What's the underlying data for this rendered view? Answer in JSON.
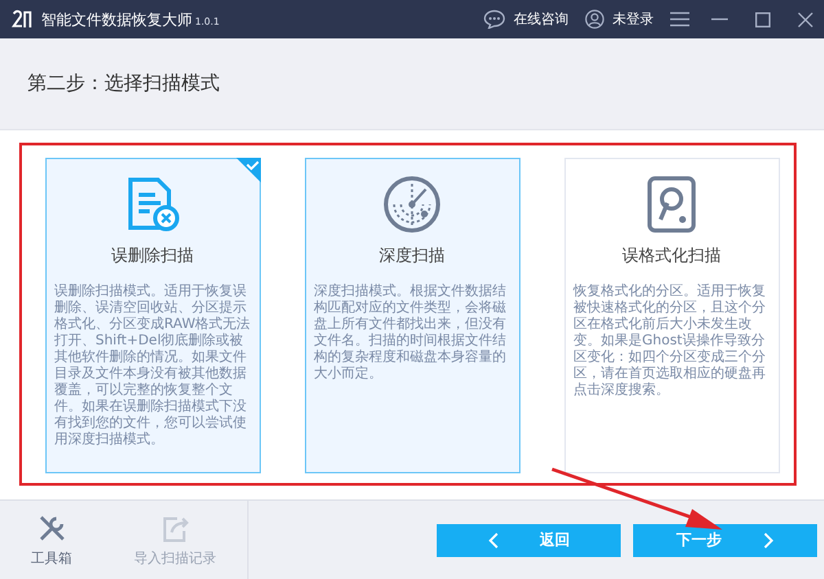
{
  "window": {
    "title": "智能文件数据恢复大师",
    "version": "1.0.1",
    "actions": [
      {
        "kind": "chat",
        "label": "在线咨询"
      },
      {
        "kind": "user",
        "label": "未登录"
      }
    ]
  },
  "step_title": "第二步：选择扫描模式",
  "modes": [
    {
      "kind": "deleted",
      "title": "误删除扫描",
      "selected": true,
      "highlighted": true,
      "description": "误删除扫描模式。适用于恢复误删除、误清空回收站、分区提示格式化、分区变成RAW格式无法打开、Shift+Del彻底删除或被其他软件删除的情况。如果文件目录及文件本身没有被其他数据覆盖，可以完整的恢复整个文件。如果在误删除扫描模式下没有找到您的文件，您可以尝试使用深度扫描模式。"
    },
    {
      "kind": "deep",
      "title": "深度扫描",
      "selected": false,
      "highlighted": true,
      "description": "深度扫描模式。根据文件数据结构匹配对应的文件类型，会将磁盘上所有文件都找出来，但没有文件名。扫描的时间根据文件结构的复杂程度和磁盘本身容量的大小而定。"
    },
    {
      "kind": "format",
      "title": "误格式化扫描",
      "selected": false,
      "highlighted": false,
      "description": "恢复格式化的分区。适用于恢复被快速格式化的分区，且这个分区在格式化前后大小未发生改变。如果是Ghost误操作导致分区变化：如四个分区变成三个分区，请在首页选取相应的硬盘再点击深度搜索。"
    }
  ],
  "tools": [
    {
      "kind": "toolbox",
      "label": "工具箱",
      "disabled": false
    },
    {
      "kind": "import",
      "label": "导入扫描记录",
      "disabled": true
    }
  ],
  "buttons": [
    {
      "kind": "back",
      "label": "返回"
    },
    {
      "kind": "next",
      "label": "下一步"
    }
  ]
}
